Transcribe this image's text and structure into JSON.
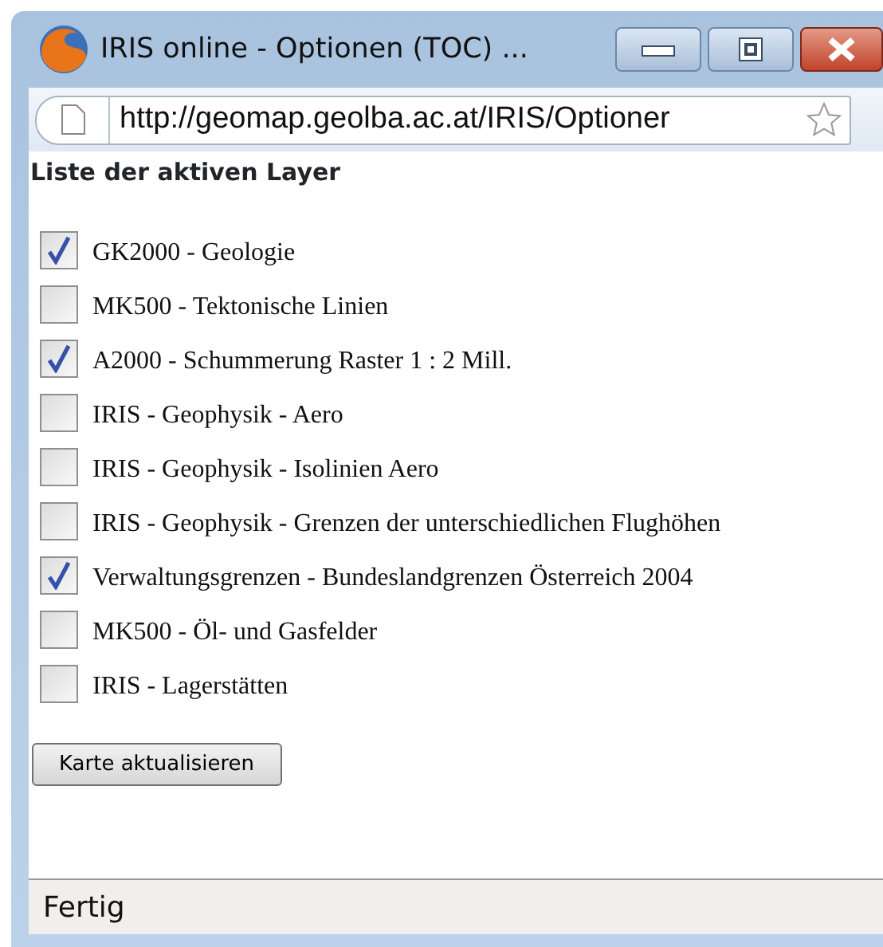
{
  "window": {
    "title": "IRIS online - Optionen (TOC) ..."
  },
  "address_bar": {
    "url": "http://geomap.geolba.ac.at/IRIS/Optioner"
  },
  "heading": "Liste der aktiven Layer",
  "layers": [
    {
      "label": "GK2000 - Geologie",
      "checked": true
    },
    {
      "label": "MK500 - Tektonische Linien",
      "checked": false
    },
    {
      "label": "A2000 - Schummerung Raster 1 : 2 Mill.",
      "checked": true
    },
    {
      "label": "IRIS - Geophysik - Aero",
      "checked": false
    },
    {
      "label": "IRIS - Geophysik - Isolinien Aero",
      "checked": false
    },
    {
      "label": "IRIS - Geophysik - Grenzen der unterschiedlichen Flughöhen",
      "checked": false
    },
    {
      "label": "Verwaltungsgrenzen - Bundeslandgrenzen Österreich 2004",
      "checked": true
    },
    {
      "label": "MK500 - Öl- und Gasfelder",
      "checked": false
    },
    {
      "label": "IRIS - Lagerstätten",
      "checked": false
    }
  ],
  "button": "Karte aktualisieren",
  "status_bar": "Fertig"
}
